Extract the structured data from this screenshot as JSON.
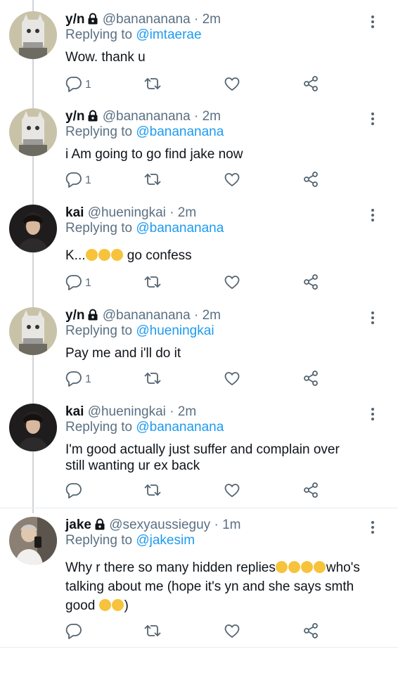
{
  "tweets": [
    {
      "name": "y/n",
      "handle": "@banananana",
      "sep": "·",
      "time": "2m",
      "replying_prefix": "Replying to",
      "replying_to": "@imtaerae",
      "text": "Wow. thank u",
      "reply_count": "1",
      "locked": true,
      "avatar": "cat-helmet"
    },
    {
      "name": "y/n",
      "handle": "@banananana",
      "sep": "·",
      "time": "2m",
      "replying_prefix": "Replying to",
      "replying_to": "@banananana",
      "text": "i Am going to go find jake now",
      "reply_count": "1",
      "locked": true,
      "avatar": "cat-helmet"
    },
    {
      "name": "kai",
      "handle": "@hueningkai",
      "sep": "·",
      "time": "2m",
      "replying_prefix": "Replying to",
      "replying_to": "@banananana",
      "text_pre": "K...",
      "text_post": " go confess",
      "reply_count": "1",
      "locked": false,
      "avatar": "boy-dark"
    },
    {
      "name": "y/n",
      "handle": "@banananana",
      "sep": "·",
      "time": "2m",
      "replying_prefix": "Replying to",
      "replying_to": "@hueningkai",
      "text": "Pay me and i'll do it",
      "reply_count": "1",
      "locked": true,
      "avatar": "cat-helmet"
    },
    {
      "name": "kai",
      "handle": "@hueningkai",
      "sep": "·",
      "time": "2m",
      "replying_prefix": "Replying to",
      "replying_to": "@banananana",
      "text": "I'm good actually just suffer and complain over still wanting ur ex back",
      "reply_count": "",
      "locked": false,
      "avatar": "boy-dark"
    },
    {
      "name": "jake",
      "handle": "@sexyaussieguy",
      "sep": "·",
      "time": "1m",
      "replying_prefix": "Replying to",
      "replying_to": "@jakesim",
      "text_pre": "Why r there so many hidden replies",
      "text_mid": "who's talking about me (hope it's yn and she says smth good ",
      "text_post": ")",
      "reply_count": "",
      "locked": true,
      "avatar": "boy-mirror"
    }
  ],
  "icons": {
    "reply": "reply-icon",
    "retweet": "retweet-icon",
    "like": "heart-icon",
    "share": "share-icon",
    "more": "more-vertical-icon",
    "lock": "lock-icon"
  },
  "colors": {
    "link": "#1d9bf0",
    "muted": "#5b7083",
    "text": "#0f1419",
    "divider": "#e6ecf0"
  }
}
